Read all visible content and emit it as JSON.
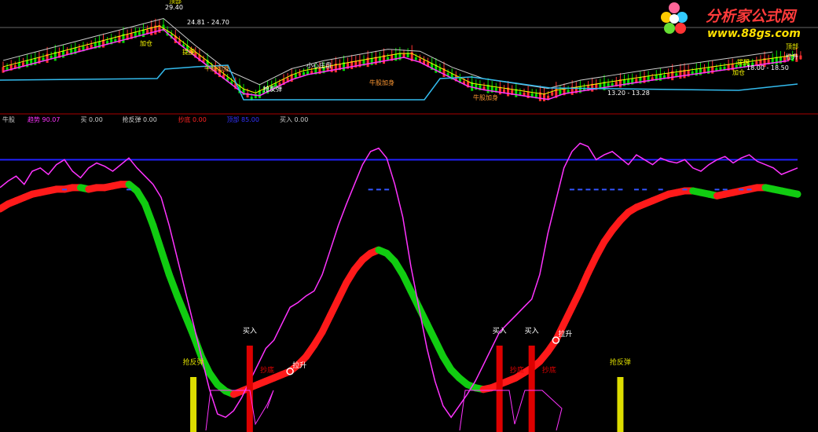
{
  "watermark": {
    "brand": "分析家公式网",
    "url": "www.88gs.com"
  },
  "indicator_bar": {
    "items": [
      {
        "label": "牛股",
        "value": "",
        "color": "#cccccc"
      },
      {
        "label": "趋势",
        "value": "90.07",
        "color": "#ff33ff"
      },
      {
        "label": "买",
        "value": "0.00",
        "color": "#cccccc"
      },
      {
        "label": "抢反弹",
        "value": "0.00",
        "color": "#cccccc"
      },
      {
        "label": "抄底",
        "value": "0.00",
        "color": "#ff2222"
      },
      {
        "label": "顶部",
        "value": "85.00",
        "color": "#3333ff"
      },
      {
        "label": "买入",
        "value": "0.00",
        "color": "#cccccc"
      }
    ]
  },
  "price_panel": {
    "range_labels": [
      "24.81 - 24.70",
      "18.00 - 18.50",
      "13.20 - 13.28"
    ],
    "high_label": "29.40",
    "annotations": [
      "顶部",
      "顶部",
      "加仓",
      "加仓",
      "提醒",
      "提醒",
      "牛股加身",
      "牛股加身",
      "牛股加身",
      "小心庄盘",
      "抢反弹",
      "拉升"
    ]
  },
  "chart_data": {
    "type": "line",
    "x_count": 100,
    "series": [
      {
        "name": "趋势",
        "color": "#ff33ff",
        "values": [
          78,
          82,
          85,
          80,
          88,
          90,
          86,
          92,
          95,
          88,
          84,
          90,
          93,
          91,
          88,
          92,
          96,
          90,
          85,
          80,
          72,
          55,
          35,
          15,
          -5,
          -25,
          -45,
          -60,
          -62,
          -58,
          -50,
          -40,
          -30,
          -20,
          -15,
          -5,
          5,
          8,
          12,
          15,
          25,
          40,
          55,
          68,
          80,
          92,
          100,
          102,
          96,
          80,
          60,
          30,
          5,
          -20,
          -40,
          -55,
          -62,
          -55,
          -48,
          -40,
          -30,
          -20,
          -10,
          -5,
          0,
          5,
          10,
          25,
          50,
          70,
          90,
          100,
          105,
          103,
          95,
          98,
          100,
          96,
          92,
          98,
          95,
          92,
          96,
          94,
          93,
          95,
          90,
          88,
          92,
          95,
          97,
          93,
          96,
          98,
          94,
          92,
          90,
          86,
          88,
          90
        ]
      },
      {
        "name": "牛股",
        "color": "#ff2020",
        "values": [
          65,
          68,
          70,
          72,
          74,
          75,
          76,
          77,
          77,
          78,
          78,
          77,
          78,
          78,
          79,
          80,
          80,
          76,
          68,
          55,
          40,
          25,
          12,
          0,
          -12,
          -25,
          -35,
          -42,
          -46,
          -48,
          -46,
          -44,
          -42,
          -40,
          -38,
          -36,
          -34,
          -30,
          -25,
          -18,
          -10,
          0,
          10,
          20,
          28,
          34,
          38,
          40,
          38,
          33,
          25,
          15,
          5,
          -5,
          -15,
          -25,
          -33,
          -38,
          -42,
          -44,
          -45,
          -44,
          -42,
          -40,
          -38,
          -35,
          -32,
          -28,
          -22,
          -15,
          -5,
          5,
          15,
          26,
          36,
          45,
          52,
          58,
          63,
          66,
          68,
          70,
          72,
          74,
          75,
          76,
          76,
          75,
          74,
          73,
          74,
          75,
          76,
          77,
          78,
          78,
          77,
          76,
          75,
          74
        ]
      },
      {
        "name": "顶部",
        "color": "#2222ff",
        "values": [
          95
        ]
      }
    ],
    "signals": [
      {
        "label": "抢反弹",
        "x": 24,
        "color": "#dddd00"
      },
      {
        "label": "买入",
        "x": 31,
        "color": "#dd0000"
      },
      {
        "label": "抄底",
        "x": 32,
        "color": "#dd0000"
      },
      {
        "label": "拉升",
        "x": 36,
        "color": "#ffffff"
      },
      {
        "label": "买入",
        "x": 62,
        "color": "#dd0000"
      },
      {
        "label": "抄底",
        "x": 63,
        "color": "#dd0000"
      },
      {
        "label": "买入",
        "x": 66,
        "color": "#dd0000"
      },
      {
        "label": "抄底",
        "x": 67,
        "color": "#dd0000"
      },
      {
        "label": "拉升",
        "x": 69,
        "color": "#ffffff"
      },
      {
        "label": "抢反弹",
        "x": 77,
        "color": "#dddd00"
      }
    ],
    "ylim": [
      -70,
      110
    ],
    "grid": false,
    "legend": "none"
  }
}
